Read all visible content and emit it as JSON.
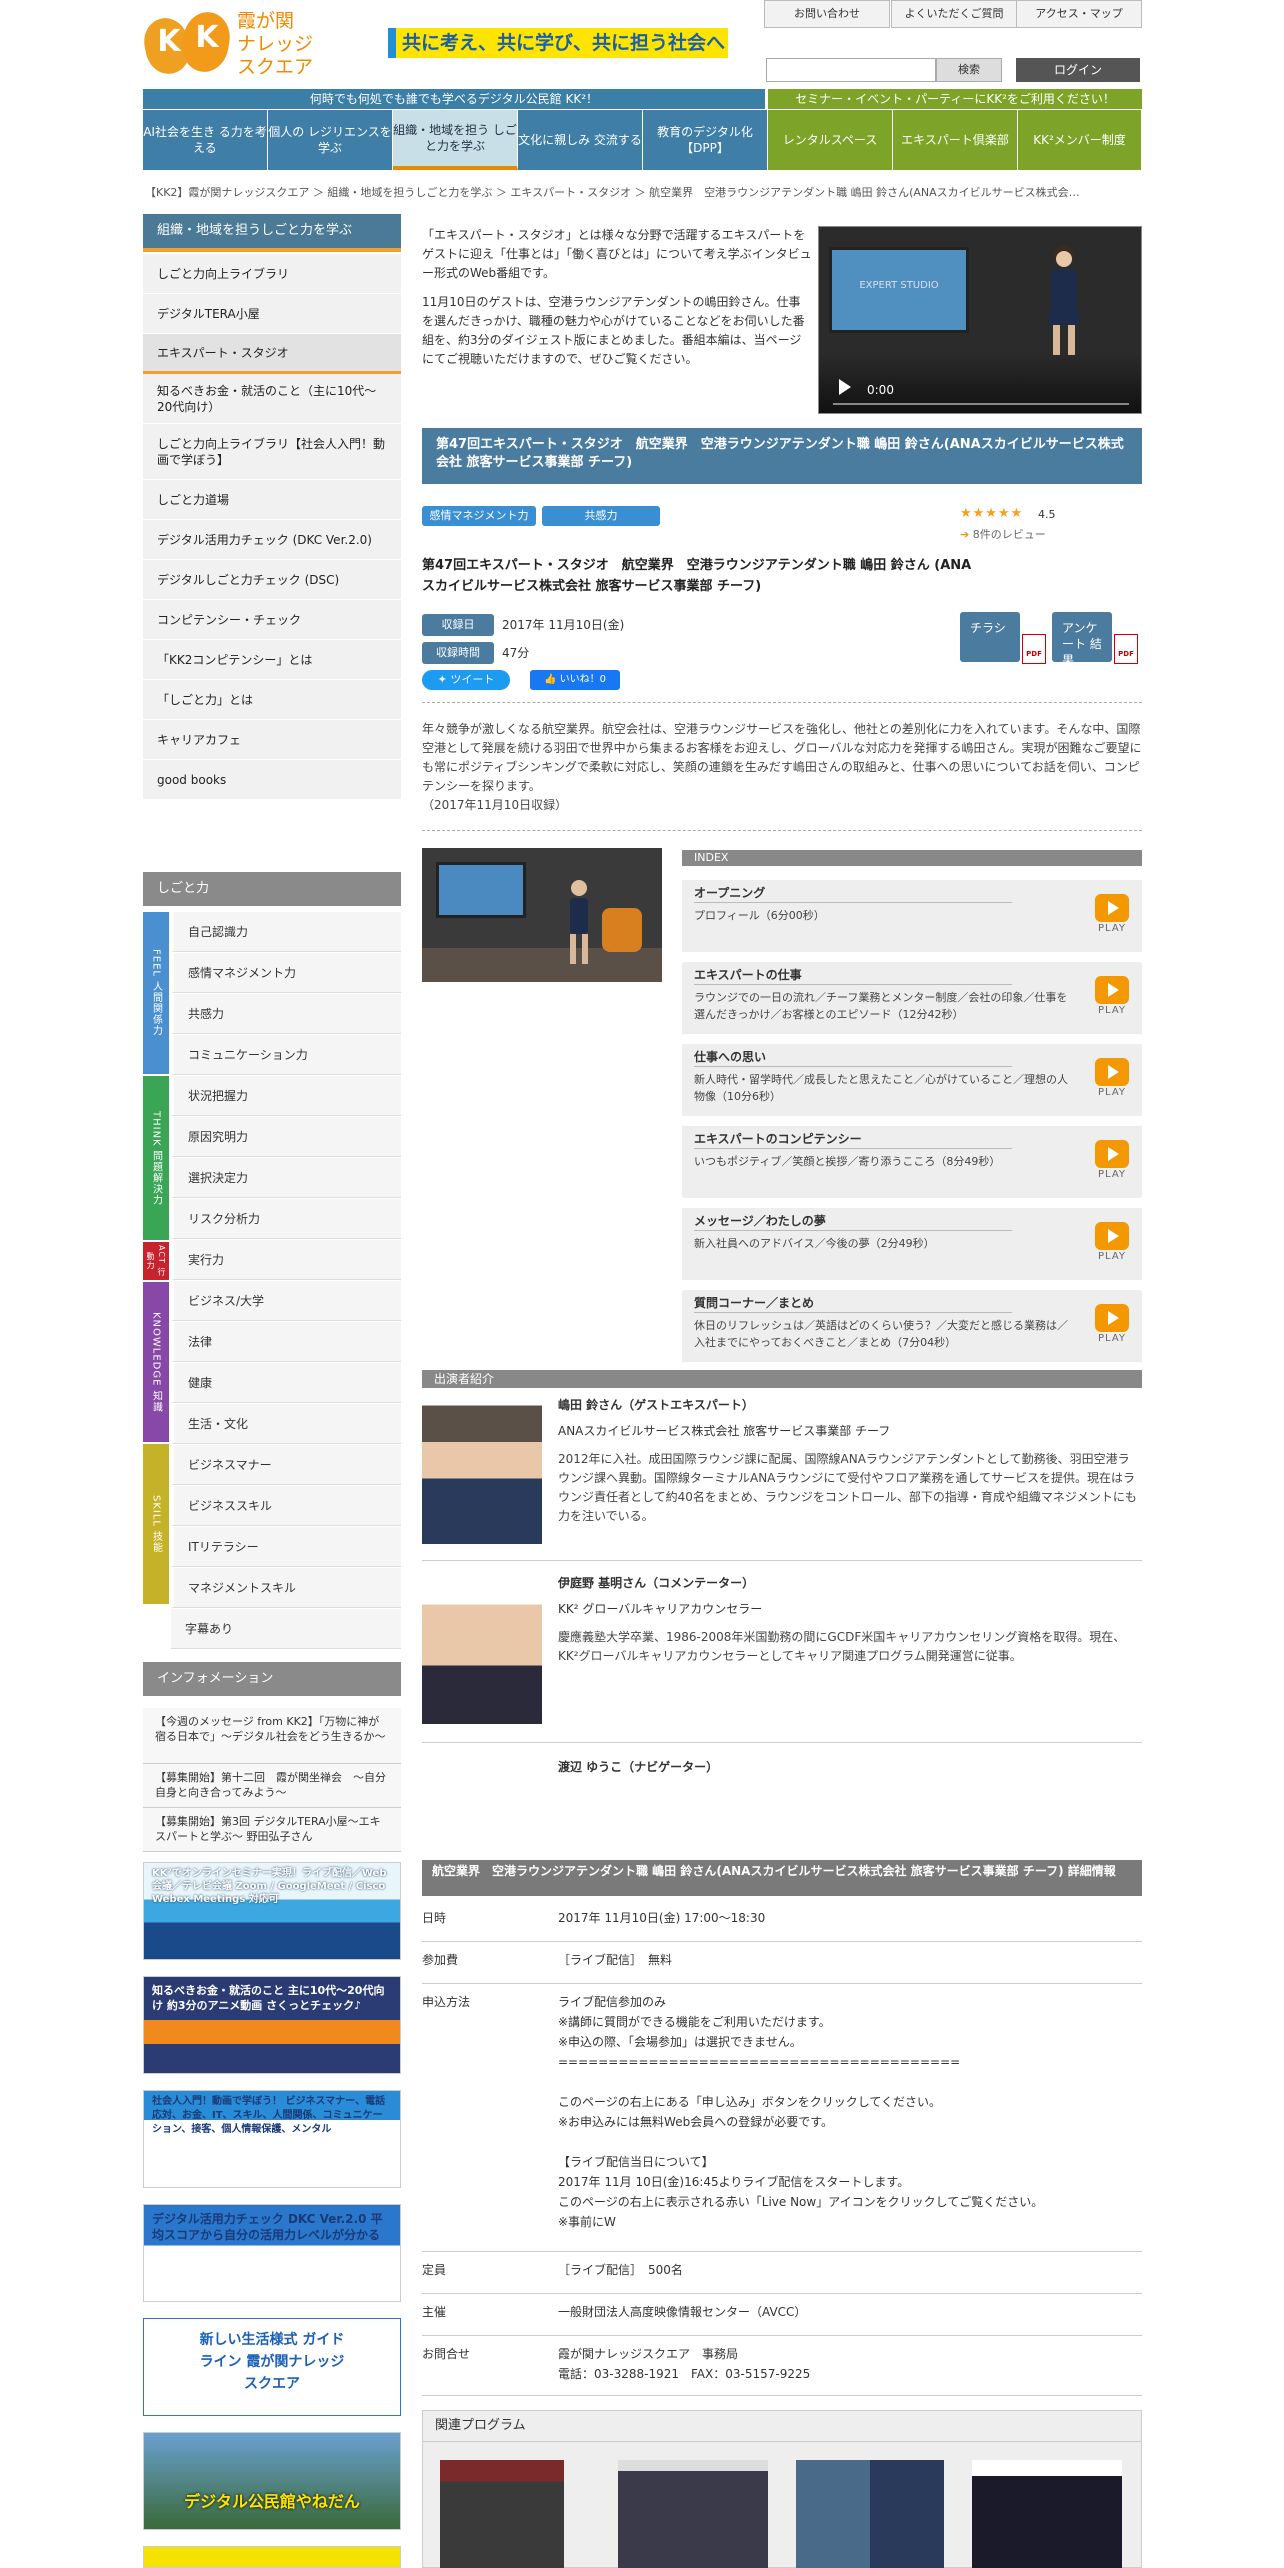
{
  "header": {
    "logo_text": "霞が関\nナレッジ\nスクエア",
    "slogan": "共に考え、共に学び、共に担う社会へ",
    "top_links": [
      "お問い合わせ",
      "よくいただくご質問",
      "アクセス・マップ"
    ],
    "search_button": "検索",
    "login": "ログイン",
    "tagline_left": "何時でも何処でも誰でも学べるデジタル公民館 KK²！",
    "tagline_right": "セミナー・イベント・パーティーにKK²をご利用ください！"
  },
  "nav": [
    {
      "label": "AI社会を生き る力を考える",
      "color": "#3f7ea6"
    },
    {
      "label": "個人の レジリエンスを 学ぶ",
      "color": "#3f7ea6"
    },
    {
      "label": "組織・地域を担う しごと力を学ぶ",
      "color": "#c8dfe8"
    },
    {
      "label": "文化に親しみ 交流する",
      "color": "#3f7ea6"
    },
    {
      "label": "教育のデジタル化 【DPP】",
      "color": "#3f7ea6"
    },
    {
      "label": "レンタルスペース",
      "color": "#7da428"
    },
    {
      "label": "エキスパート倶楽部",
      "color": "#7da428"
    },
    {
      "label": "KK²メンバー制度",
      "color": "#7da428"
    }
  ],
  "breadcrumb": "【KK2】霞が関ナレッジスクエア ＞ 組織・地域を担うしごと力を学ぶ ＞ エキスパート・スタジオ ＞ 航空業界　空港ラウンジアテンダント職 嶋田 鈴さん(ANAスカイビルサービス株式会…",
  "sidebar": {
    "head": "組織・地域を担うしごと力を学ぶ",
    "items": [
      "しごと力向上ライブラリ",
      "デジタルTERA小屋",
      "エキスパート・スタジオ",
      "知るべきお金・就活のこと（主に10代～20代向け）",
      "しごと力向上ライブラリ【社会人入門！動画で学ぼう】",
      "しごと力道場",
      "デジタル活用力チェック (DKC Ver.2.0)",
      "デジタルしごと力チェック (DSC)",
      "コンピテンシー・チェック",
      "「KK2コンピテンシー」とは",
      "「しごと力」とは",
      "キャリアカフェ",
      "good books"
    ],
    "skill_head": "しごと力",
    "bands": [
      {
        "label": "FEEL 人間関係力",
        "color": "#4a90d0"
      },
      {
        "label": "THINK 問題解決力",
        "color": "#3aa655"
      },
      {
        "label": "ACT 行動力",
        "color": "#c8232c"
      },
      {
        "label": "KNOWLEDGE 知識",
        "color": "#8848a8"
      },
      {
        "label": "SKILL 技能",
        "color": "#c5b228"
      }
    ],
    "skill_items": [
      "自己認識力",
      "感情マネジメント力",
      "共感力",
      "コミュニケーション力",
      "状況把握力",
      "原因究明力",
      "選択決定力",
      "リスク分析力",
      "実行力",
      "ビジネス/大学",
      "法律",
      "健康",
      "生活・文化",
      "ビジネスマナー",
      "ビジネススキル",
      "ITリテラシー",
      "マネジメントスキル",
      "字幕あり"
    ],
    "info_head": "インフォメーション",
    "info_items": [
      "【今週のメッセージ from KK2】「万物に神が宿る日本で」～デジタル社会をどう生きるか～",
      "【募集開始】第十二回　霞が関坐禅会　～自分自身と向き合ってみよう～",
      "【募集開始】第3回 デジタルTERA小屋～エキスパートと学ぶ～ 野田弘子さん"
    ],
    "banners": [
      "KK²でオンラインセミナー実現！ライブ配信／Web会議／テレビ会議 Zoom / GoogleMeet / Cisco Webex Meetings 対応可",
      "知るべきお金・就活のこと 主に10代～20代向け 約3分のアニメ動画 さくっとチェック♪",
      "社会人入門！動画で学ぼう！ ビジネスマナー、電話応対、お金、IT、スキル、人間関係、コミュニケーション、接客、個人情報保護、メンタル",
      "デジタル活用力チェック DKC Ver.2.0 平均スコアから自分の活用力レベルが分かる",
      "新しい生活様式 ガイドライン 霞が関ナレッジスクエア",
      "デジタル公民館やねだん"
    ]
  },
  "intro": {
    "p1": "「エキスパート・スタジオ」とは様々な分野で活躍するエキスパートをゲストに迎え「仕事とは」「働く喜びとは」について考え学ぶインタビュー形式のWeb番組です。",
    "p2": "11月10日のゲストは、空港ラウンジアテンダントの嶋田鈴さん。仕事を選んだきっかけ、職種の魅力や心がけていることなどをお伺いした番組を、約3分のダイジェスト版にまとめました。番組本編は、当ページにてご視聴いただけますので、ぜひご覧ください。"
  },
  "video": {
    "time": "0:00",
    "screen_text": "EXPERT STUDIO"
  },
  "program": {
    "title": "第47回エキスパート・スタジオ　航空業界　空港ラウンジアテンダント職 嶋田 鈴さん(ANAスカイビルサービス株式会社 旅客サービス事業部 チーフ)",
    "tags": [
      "感情マネジメント力",
      "共感力"
    ],
    "stars": "★★★★★",
    "rating": "4.5",
    "reviews": "8件のレビュー",
    "subtitle": "第47回エキスパート・スタジオ　航空業界　空港ラウンジアテンダント職 嶋田 鈴さん (ANAスカイビルサービス株式会社 旅客サービス事業部 チーフ)",
    "date_label": "収録日",
    "date": "2017年 11月10日(金)",
    "duration_label": "収録時間",
    "duration": "47分",
    "flyer": "チラシ",
    "survey": "アンケート 結 果",
    "tweet": "ツイート",
    "like": "いいね！0",
    "desc": "年々競争が激しくなる航空業界。航空会社は、空港ラウンジサービスを強化し、他社との差別化に力を入れています。そんな中、国際空港として発展を続ける羽田で世界中から集まるお客様をお迎えし、グローバルな対応力を発揮する嶋田さん。実現が困難なご要望にも常にポジティブシンキングで柔軟に対応し、笑顔の連鎖を生みだす嶋田さんの取組みと、仕事への思いについてお話を伺い、コンピテンシーを探ります。\n（2017年11月10日収録）"
  },
  "index": {
    "head": "INDEX",
    "play": "PLAY",
    "items": [
      {
        "title": "オープニング",
        "desc": "プロフィール（6分00秒）"
      },
      {
        "title": "エキスパートの仕事",
        "desc": "ラウンジでの一日の流れ／チーフ業務とメンター制度／会社の印象／仕事を選んだきっかけ／お客様とのエピソード（12分42秒）"
      },
      {
        "title": "仕事への思い",
        "desc": "新人時代・留学時代／成長したと思えたこと／心がけていること／理想の人物像（10分6秒）"
      },
      {
        "title": "エキスパートのコンピテンシー",
        "desc": "いつもポジティブ／笑顔と挨拶／寄り添うこころ（8分49秒）"
      },
      {
        "title": "メッセージ／わたしの夢",
        "desc": "新入社員へのアドバイス／今後の夢（2分49秒）"
      },
      {
        "title": "質問コーナー／まとめ",
        "desc": "休日のリフレッシュは／英語はどのくらい使う？／大変だと感じる業務は／入社までにやっておくべきこと／まとめ（7分04秒）"
      }
    ]
  },
  "cast": {
    "head": "出演者紹介",
    "people": [
      {
        "name": "嶋田 鈴さん（ゲストエキスパート）",
        "role": "ANAスカイビルサービス株式会社 旅客サービス事業部 チーフ",
        "bio": "2012年に入社。成田国際ラウンジ課に配属、国際線ANAラウンジアテンダントとして勤務後、羽田空港ラウンジ課へ異動。国際線ターミナルANAラウンジにて受付やフロア業務を通してサービスを提供。現在はラウンジ責任者として約40名をまとめ、ラウンジをコントロール、部下の指導・育成や組織マネジメントにも力を注いでいる。"
      },
      {
        "name": "伊庭野 基明さん（コメンテーター）",
        "role": "KK² グローバルキャリアカウンセラー",
        "bio": "慶應義塾大学卒業、1986-2008年米国勤務の間にGCDF米国キャリアカウンセリング資格を取得。現在、KK²グローバルキャリアカウンセラーとしてキャリア関連プログラム開発運営に従事。"
      },
      {
        "name": "渡辺 ゆうこ（ナビゲーター）",
        "role": "",
        "bio": ""
      }
    ]
  },
  "details": {
    "head": "航空業界　空港ラウンジアテンダント職 嶋田 鈴さん(ANAスカイビルサービス株式会社 旅客サービス事業部 チーフ) 詳細情報",
    "rows": [
      {
        "label": "日時",
        "value": "2017年 11月10日(金) 17:00～18:30"
      },
      {
        "label": "参加費",
        "value": "［ライブ配信］　無料"
      },
      {
        "label": "申込方法",
        "value": "ライブ配信参加のみ\n※講師に質問ができる機能をご利用いただけます。\n※申込の際、「会場参加」は選択できません。\n========================================\n\nこのページの右上にある「申し込み」ボタンをクリックしてください。\n※お申込みには無料Web会員への登録が必要です。\n\n【ライブ配信当日について】\n2017年 11月 10日(金)16:45よりライブ配信をスタートします。\nこのページの右上に表示される赤い「Live Now」アイコンをクリックしてご覧ください。\n※事前にW"
      },
      {
        "label": "定員",
        "value": "［ライブ配信］　500名"
      },
      {
        "label": "主催",
        "value": "一般財団法人高度映像情報センター（AVCC）"
      },
      {
        "label": "お問合せ",
        "value": "霞が関ナレッジスクエア　事務局\n電話：03-3288-1921　FAX：03-5157-9225"
      }
    ]
  },
  "related": {
    "head": "関連プログラム"
  }
}
